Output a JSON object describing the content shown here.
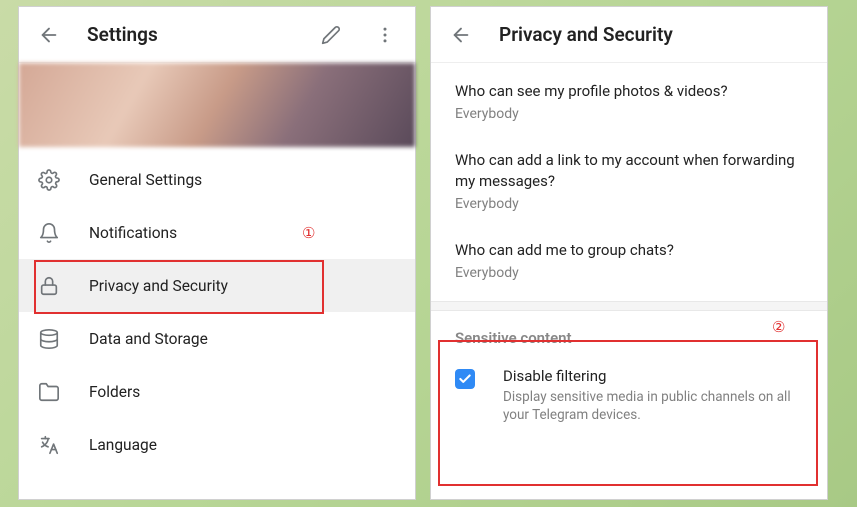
{
  "settings": {
    "title": "Settings",
    "menu": [
      {
        "label": "General Settings"
      },
      {
        "label": "Notifications"
      },
      {
        "label": "Privacy and Security"
      },
      {
        "label": "Data and Storage"
      },
      {
        "label": "Folders"
      },
      {
        "label": "Language"
      }
    ]
  },
  "privacy": {
    "title": "Privacy and Security",
    "items": [
      {
        "question": "Who can see my profile photos & videos?",
        "value": "Everybody"
      },
      {
        "question": "Who can add a link to my account when forwarding my messages?",
        "value": "Everybody"
      },
      {
        "question": "Who can add me to group chats?",
        "value": "Everybody"
      }
    ],
    "sensitive": {
      "section_title": "Sensitive content",
      "label": "Disable filtering",
      "desc": "Display sensitive media in public channels on all your Telegram devices.",
      "checked": true
    }
  },
  "annotations": {
    "c1": "①",
    "c2": "②"
  }
}
